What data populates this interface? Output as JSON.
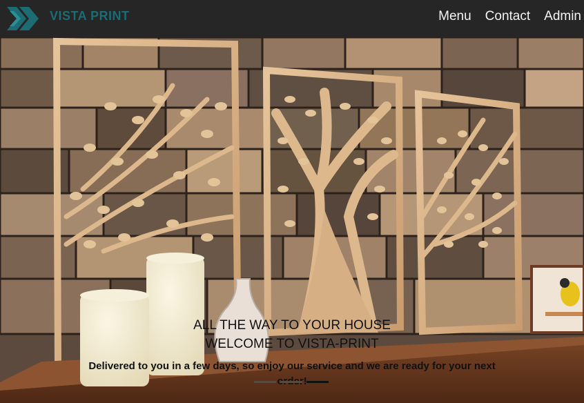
{
  "navbar": {
    "brand": "VISTA PRINT",
    "links": [
      "Menu",
      "Contact",
      "Admin"
    ]
  },
  "hero": {
    "line1": "ALL THE WAY TO YOUR HOUSE",
    "line2": "WELCOME TO VISTA-PRINT",
    "line3": "Delivered to you in a few days, so enjoy our service and we are ready for your next order!"
  },
  "carousel": {
    "slide_count": 3,
    "active_index": 2
  },
  "colors": {
    "navbar_bg": "#262626",
    "brand": "#1d6b73",
    "nav_link": "#f4f4f4"
  }
}
